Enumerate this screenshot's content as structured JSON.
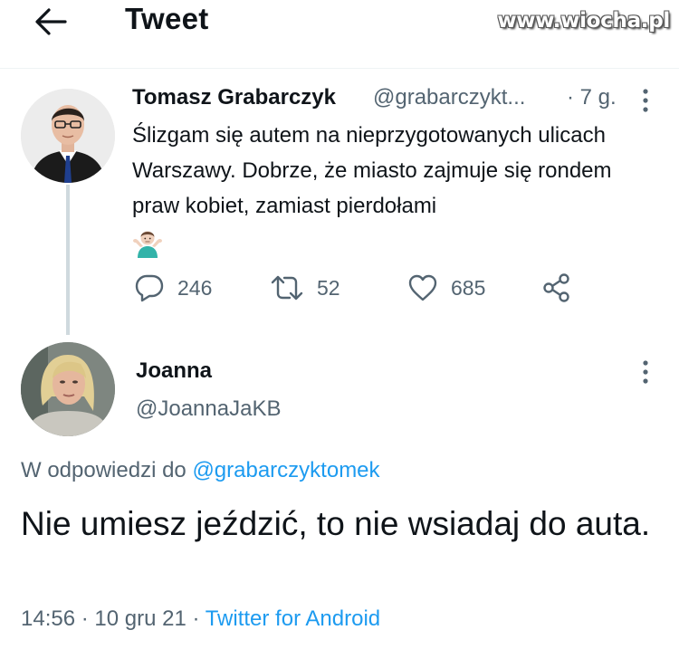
{
  "header": {
    "title": "Tweet",
    "back_icon": "arrow-left-icon",
    "watermark": "www.wiocha.pl"
  },
  "tweet": {
    "author_name": "Tomasz Grabarczyk",
    "author_handle": "@grabarczykt...",
    "time": "· 7 g.",
    "text": "Ślizgam się autem na nieprzygotowanych ulicach Warszawy. Dobrze, że miasto zajmuje się rondem praw kobiet, zamiast pierdołami",
    "emoji": "man-shrugging-emoji",
    "actions": {
      "replies": "246",
      "retweets": "52",
      "likes": "685"
    }
  },
  "reply": {
    "author_name": "Joanna",
    "author_handle": "@JoannaJaKB",
    "reply_prefix": "W odpowiedzi do",
    "reply_mention": "@grabarczyktomek",
    "text": "Nie umiesz jeździć, to nie wsiadaj do auta.",
    "time": "14:56 · 10 gru 21 ·",
    "client": "Twitter for Android"
  },
  "colors": {
    "text": "#0f1419",
    "secondary": "#536471",
    "accent": "#1d9bf0",
    "thread_line": "#cfd9de"
  }
}
